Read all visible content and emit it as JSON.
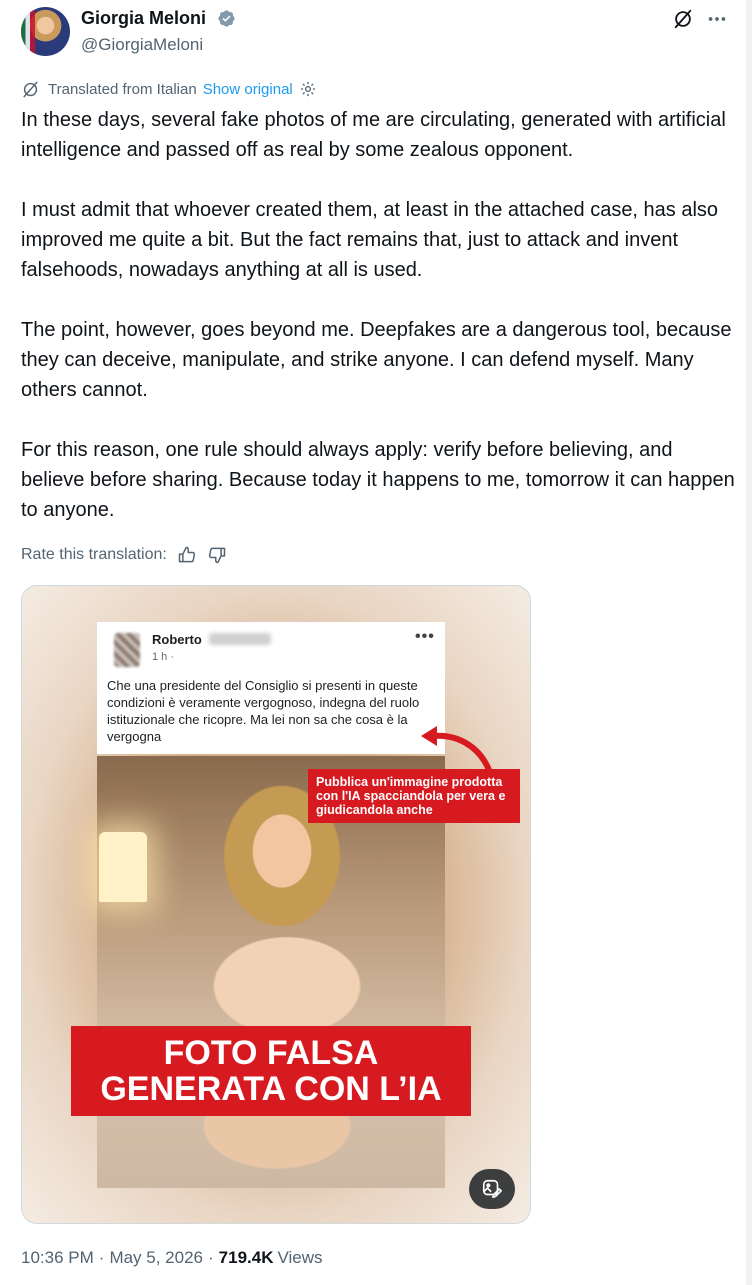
{
  "author": {
    "name": "Giorgia Meloni",
    "handle": "@GiorgiaMeloni",
    "verified_icon": "verified-badge-icon"
  },
  "translation": {
    "label": "Translated from Italian",
    "show_original": "Show original"
  },
  "tweet": {
    "paragraphs": [
      "In these days, several fake photos of me are circulating, generated with artificial intelligence and passed off as real by some zealous opponent.",
      "I must admit that whoever created them, at least in the attached case, has also improved me quite a bit. But the fact remains that, just to attack and invent falsehoods, nowadays anything at all is used.",
      "The point, however, goes beyond me. Deepfakes are a dangerous tool, because they can deceive, manipulate, and strike anyone. I can defend myself. Many others cannot.",
      "For this reason, one rule should always apply: verify before believing, and believe before sharing. Because today it happens to me, tomorrow it can happen to anyone."
    ]
  },
  "rate": {
    "label": "Rate this translation:"
  },
  "media": {
    "fb_post": {
      "name": "Roberto",
      "time": "1 h ·",
      "more": "•••",
      "text": "Che una presidente del Consiglio  si presenti in queste condizioni è veramente vergognoso, indegna del ruolo istituzionale che ricopre. Ma lei non sa che cosa è la vergogna"
    },
    "red_note": "Pubblica un'immagine prodotta con l'IA spacciandola per vera e giudicandola anche",
    "banner_line1": "FOTO FALSA",
    "banner_line2": "GENERATA CON L’IA"
  },
  "meta": {
    "time": "10:36 PM",
    "date": "May 5, 2026",
    "views_count": "719.4K",
    "views_label": "Views"
  },
  "colors": {
    "link": "#1d9bf0",
    "secondary": "#536471",
    "text": "#0f1419",
    "alert_red": "#d71920"
  }
}
